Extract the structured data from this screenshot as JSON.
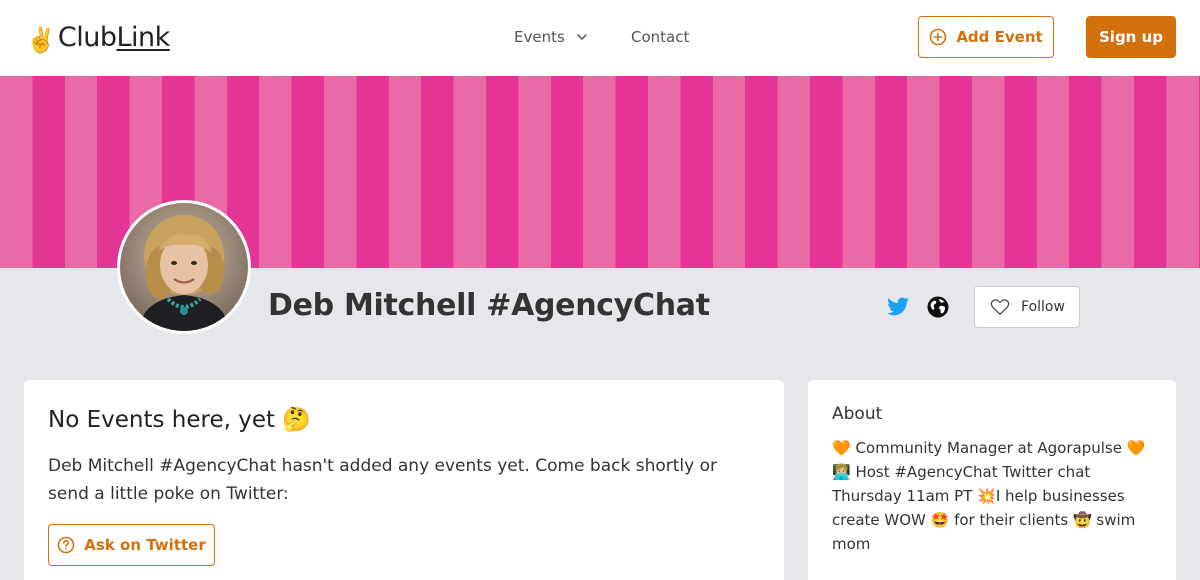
{
  "brand": {
    "logo_emoji": "✌️",
    "logo_part1": "Club",
    "logo_part2": "Link",
    "accent_color": "#d2700c"
  },
  "nav": {
    "events_label": "Events",
    "contact_label": "Contact"
  },
  "header_actions": {
    "add_event_label": "Add Event",
    "sign_up_label": "Sign up"
  },
  "banner": {
    "colors": [
      "#ea6aa8",
      "#e43494"
    ]
  },
  "profile": {
    "name": "Deb Mitchell #AgencyChat",
    "follow_label": "Follow",
    "icons": [
      "twitter-icon",
      "globe-icon",
      "heart-icon"
    ]
  },
  "events_card": {
    "title": "No Events here, yet 🤔",
    "message": "Deb Mitchell #AgencyChat hasn't added any events yet. Come back shortly or send a little poke on Twitter:",
    "ask_label": "Ask on Twitter"
  },
  "about_card": {
    "title": "About",
    "text": "🧡 Community Manager at Agorapulse 🧡 👩🏼‍💻 Host #AgencyChat Twitter chat Thursday 11am PT 💥I help businesses create WOW 🤩 for their clients 🤠 swim mom"
  }
}
